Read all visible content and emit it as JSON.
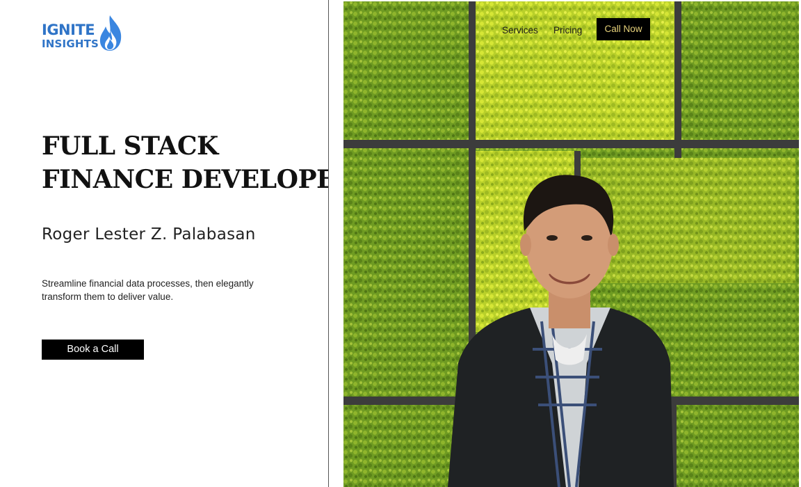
{
  "brand": {
    "line1": "IGNITE",
    "line2": "INSIGHTS",
    "color": "#2f74c7",
    "flame_color": "#3a86e0"
  },
  "nav": {
    "items": [
      "Services",
      "Pricing"
    ],
    "cta": "Call Now",
    "cta_text_color": "#e7d27a"
  },
  "hero": {
    "headline_line1": "FULL STACK",
    "headline_line2": "FINANCE DEVELOPER",
    "name": "Roger Lester Z. Palabasan",
    "tagline": "Streamline financial data processes, then elegantly transform them to deliver value.",
    "button": "Book a Call"
  },
  "photo": {
    "subject": "man-smiling-in-front-of-moss-wall",
    "moss_light": "#c4d82a",
    "moss_dark": "#6e9a24",
    "frame_color": "#3c3c3c"
  }
}
